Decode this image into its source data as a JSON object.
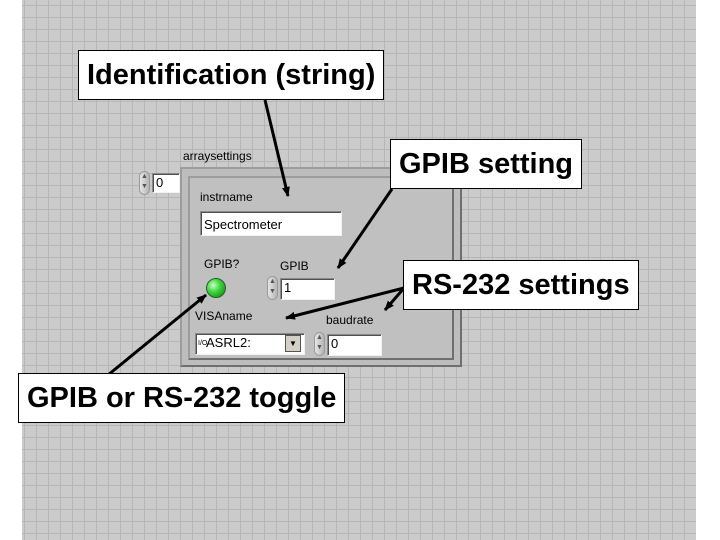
{
  "callouts": {
    "identification": "Identification (string)",
    "gpib_setting": "GPIB setting",
    "rs232_settings": "RS-232 settings",
    "toggle": "GPIB or RS-232 toggle"
  },
  "array": {
    "label": "arraysettings",
    "index_value": "0"
  },
  "cluster": {
    "instrname_label": "instrname",
    "instrname_value": "Spectrometer",
    "gpib_led_label": "GPIB?",
    "gpib_led_state": "on",
    "gpib_address_label": "GPIB",
    "gpib_address_value": "1",
    "visaname_label": "VISAname",
    "visaname_value": "ASRL2:",
    "visa_io_glyph": "I/O",
    "baudrate_label": "baudrate",
    "baudrate_value": "0"
  },
  "colors": {
    "led_on": "#3cd83c",
    "arrow": "#000000",
    "panel": "#c0c0c0"
  },
  "icons": {
    "spinner": "increment-decrement-icon",
    "dropdown": "chevron-down-icon"
  }
}
